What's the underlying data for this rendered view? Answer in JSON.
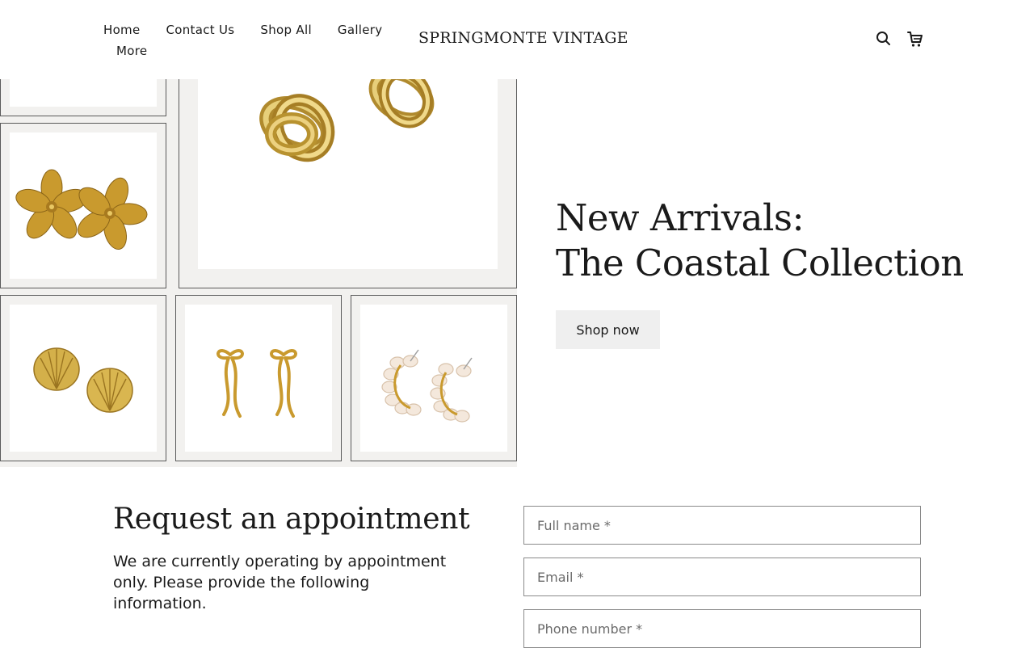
{
  "header": {
    "nav": [
      {
        "label": "Home"
      },
      {
        "label": "Contact Us"
      },
      {
        "label": "Shop All"
      },
      {
        "label": "Gallery"
      },
      {
        "label": "More"
      }
    ],
    "brand": "SPRINGMONTE VINTAGE",
    "icons": {
      "search": "search-icon",
      "cart": "cart-icon"
    }
  },
  "hero": {
    "title_line1": "New Arrivals:",
    "title_line2": "The Coastal Collection",
    "cta_label": "Shop now",
    "collage_items": [
      "knot-earrings",
      "flower-earrings",
      "shell-earrings",
      "bow-earrings",
      "pearl-hoop-earrings"
    ]
  },
  "appointment": {
    "title": "Request an appointment",
    "description": "We are currently operating by appointment only. Please provide the following information.",
    "fields": [
      {
        "placeholder": "Full name *"
      },
      {
        "placeholder": "Email *"
      },
      {
        "placeholder": "Phone number *"
      }
    ]
  },
  "colors": {
    "text": "#1a1a1a",
    "collage_bg": "#f2f1ef",
    "button_bg": "#efefef",
    "gold": "#c9a227"
  }
}
